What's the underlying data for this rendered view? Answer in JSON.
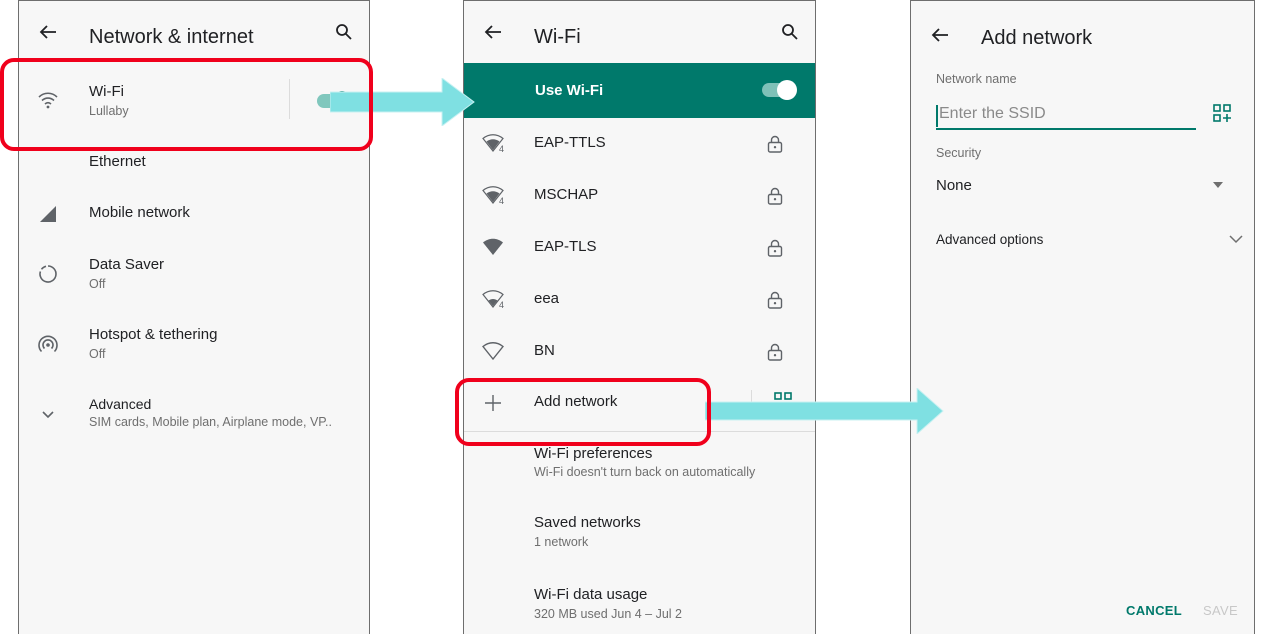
{
  "screen1": {
    "title": "Network & internet",
    "items": [
      {
        "label": "Wi-Fi",
        "sub": "Lullaby",
        "icon": "wifi-icon"
      },
      {
        "label": "Ethernet",
        "sub": ""
      },
      {
        "label": "Mobile network",
        "sub": "",
        "icon": "cellular-signal-icon"
      },
      {
        "label": "Data Saver",
        "sub": "Off",
        "icon": "data-saver-icon"
      },
      {
        "label": "Hotspot & tethering",
        "sub": "Off",
        "icon": "hotspot-icon"
      },
      {
        "label": "Advanced",
        "sub": "SIM cards, Mobile plan, Airplane mode, VP..",
        "icon": "chevron-down-icon"
      }
    ],
    "wifi_toggle_on": true
  },
  "screen2": {
    "title": "Wi-Fi",
    "use_wifi_label": "Use Wi-Fi",
    "use_wifi_on": true,
    "networks": [
      {
        "name": "EAP-TTLS",
        "badge": "4",
        "locked": true
      },
      {
        "name": "MSCHAP",
        "badge": "4",
        "locked": true
      },
      {
        "name": "EAP-TLS",
        "badge": "",
        "locked": true
      },
      {
        "name": "eea",
        "badge": "4",
        "locked": true
      },
      {
        "name": "BN",
        "badge": "",
        "locked": true
      }
    ],
    "add_network_label": "Add network",
    "preferences": [
      {
        "label": "Wi-Fi preferences",
        "sub": "Wi-Fi doesn't turn back on automatically"
      },
      {
        "label": "Saved networks",
        "sub": "1 network"
      },
      {
        "label": "Wi-Fi data usage",
        "sub": "320 MB used Jun 4 – Jul 2"
      }
    ]
  },
  "screen3": {
    "title": "Add network",
    "network_name_label": "Network name",
    "ssid_placeholder": "Enter the SSID",
    "security_label": "Security",
    "security_value": "None",
    "advanced_options_label": "Advanced options",
    "cancel_label": "CANCEL",
    "save_label": "SAVE"
  },
  "colors": {
    "accent": "#00796b",
    "callout": "#f0001c",
    "arrow": "#7fe0e2"
  }
}
